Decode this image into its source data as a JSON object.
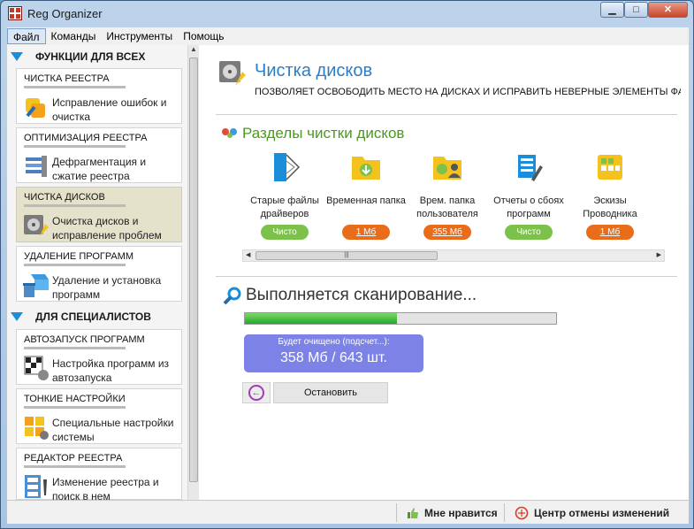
{
  "window": {
    "title": "Reg Organizer"
  },
  "menu": [
    "Файл",
    "Команды",
    "Инструменты",
    "Помощь"
  ],
  "sidebar": {
    "sections": [
      {
        "title": "ФУНКЦИИ ДЛЯ ВСЕХ",
        "items": [
          {
            "title": "ЧИСТКА РЕЕСТРА",
            "desc": "Исправление ошибок и очистка",
            "icon": "registry-clean-icon"
          },
          {
            "title": "ОПТИМИЗАЦИЯ РЕЕСТРА",
            "desc": "Дефрагментация и сжатие реестра",
            "icon": "registry-optimize-icon"
          },
          {
            "title": "ЧИСТКА ДИСКОВ",
            "desc": "Очистка дисков и исправление проблем",
            "icon": "disk-clean-icon",
            "selected": true
          },
          {
            "title": "УДАЛЕНИЕ ПРОГРАММ",
            "desc": "Удаление и установка программ",
            "icon": "uninstall-icon"
          }
        ]
      },
      {
        "title": "ДЛЯ СПЕЦИАЛИСТОВ",
        "items": [
          {
            "title": "АВТОЗАПУСК ПРОГРАММ",
            "desc": "Настройка программ из автозапуска",
            "icon": "autorun-icon"
          },
          {
            "title": "ТОНКИЕ НАСТРОЙКИ",
            "desc": "Специальные настройки системы",
            "icon": "tweaks-icon"
          },
          {
            "title": "РЕДАКТОР РЕЕСТРА",
            "desc": "Изменение реестра и поиск в нем",
            "icon": "registry-editor-icon"
          }
        ]
      }
    ]
  },
  "main": {
    "title": "Чистка дисков",
    "subtitle": "ПОЗВОЛЯЕТ ОСВОБОДИТЬ МЕСТО НА ДИСКАХ И ИСПРАВИТЬ НЕВЕРНЫЕ ЭЛЕМЕНТЫ ФАЙЛО",
    "sections_title": "Разделы чистки дисков",
    "categories": [
      {
        "label": "Старые файлы драйверов",
        "badge": "Чисто",
        "status": "clean",
        "icon": "drivers-icon"
      },
      {
        "label": "Временная папка",
        "badge": "1 Мб",
        "status": "size",
        "icon": "temp-folder-icon"
      },
      {
        "label": "Врем. папка пользователя",
        "badge": "355 Мб",
        "status": "size",
        "icon": "user-temp-folder-icon"
      },
      {
        "label": "Отчеты о сбоях программ",
        "badge": "Чисто",
        "status": "clean",
        "icon": "crash-reports-icon"
      },
      {
        "label": "Эскизы Проводника",
        "badge": "1 Мб",
        "status": "size",
        "icon": "thumbnails-icon"
      }
    ],
    "scan": {
      "title": "Выполняется сканирование...",
      "progress": 0.49,
      "result_label": "Будет очищено (подсчет...):",
      "result_value": "358 Мб / 643 шт.",
      "stop_label": "Остановить"
    }
  },
  "statusbar": {
    "like": "Мне нравится",
    "undo_center": "Центр отмены изменений"
  },
  "colors": {
    "accent": "#2e7dc4",
    "green_title": "#4a9a1c",
    "badge_green": "#7cc24a",
    "badge_orange": "#e86c1a",
    "result_bg": "#7c82e6",
    "selected_card": "#e5e2cc"
  }
}
